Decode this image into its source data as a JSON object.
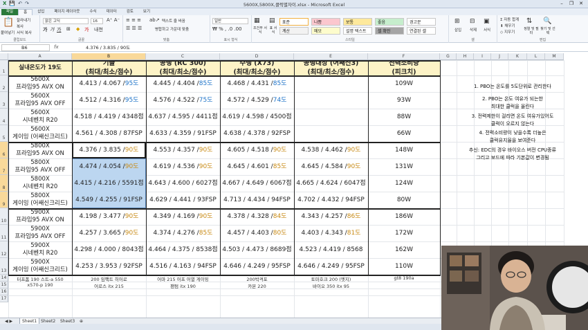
{
  "window": {
    "title": "5600X,5800X,클럭별자이.xlsx - Microsoft Excel",
    "controls": [
      "–",
      "❐",
      "✕"
    ]
  },
  "ribbon_tabs": [
    "파일",
    "홈",
    "삽입",
    "페이지 레이아웃",
    "수식",
    "데이터",
    "검토",
    "보기"
  ],
  "ribbon": {
    "paste": "붙여넣기",
    "cut": "잘라내기",
    "copy": "복사",
    "format_painter": "서식 복사",
    "font_name": "맑은 고딕",
    "font_size": "16",
    "wrap_text": "텍스트 줄 바꿈",
    "merge_center": "병합하고 가운데 맞춤",
    "number_format": "일반",
    "cond_format": "조건부 서식",
    "table_format": "표 서식",
    "styles": [
      {
        "label": "표준",
        "bg": "#ffffff",
        "border": "#f2b040"
      },
      {
        "label": "나쁨",
        "bg": "#fbc7ce",
        "border": "#c8c8c8"
      },
      {
        "label": "보통",
        "bg": "#fee99c",
        "border": "#c8c8c8"
      },
      {
        "label": "좋음",
        "bg": "#c6eecd",
        "border": "#c8c8c8"
      },
      {
        "label": "경고문",
        "bg": "#ffffff",
        "border": "#c8c8c8"
      },
      {
        "label": "계산",
        "bg": "#f2f2f2",
        "border": "#c8c8c8"
      },
      {
        "label": "메모",
        "bg": "#fdfccc",
        "border": "#c8c8c8"
      },
      {
        "label": "설명 텍스트",
        "bg": "#ffffff",
        "border": "#c8c8c8"
      },
      {
        "label": "셀 확인",
        "bg": "#a5a5a5",
        "border": "#c8c8c8"
      },
      {
        "label": "연결된 셀",
        "bg": "#ffffff",
        "border": "#c8c8c8"
      }
    ],
    "insert": "삽입",
    "delete": "삭제",
    "format": "서식",
    "autosum": "자동 합계",
    "fill": "채우기",
    "clear": "지우기",
    "sort_filter": "정렬 및 필터",
    "find_select": "찾기 및 선택",
    "groups": [
      "클립보드",
      "글꼴",
      "맞춤",
      "표시 형식",
      "스타일",
      "셀",
      "편집"
    ]
  },
  "formula_bar": {
    "name_box": "B6",
    "fx": "fx",
    "value": "4.376 / 3.835 / 90도"
  },
  "columns": [
    "A",
    "B",
    "C",
    "D",
    "E",
    "F",
    "G",
    "H",
    "I",
    "J",
    "K",
    "L",
    "M"
  ],
  "rows": [
    "1",
    "2",
    "3",
    "4",
    "5",
    "6",
    "7",
    "8",
    "9",
    "10",
    "11",
    "12",
    "13",
    "14",
    "15",
    "16",
    "17"
  ],
  "table": {
    "header_a": "실내온도가 19도",
    "headers": [
      {
        "line1": "기클",
        "line2": "(최대/최소/점수)"
      },
      {
        "line1": "공냉 (RC 300)",
        "line2": "(최대/최소/점수)"
      },
      {
        "line1": "수냉 (X73)",
        "line2": "(최대/최소/점수)"
      },
      {
        "line1": "공냉대장 (어쌔신3)",
        "line2": "(최대/최소/점수)"
      },
      {
        "line1": "전력소비량",
        "line2": "(피크치)"
      }
    ],
    "rows": [
      {
        "cpu": "5600X",
        "test": "프라임95 AVX ON",
        "b": [
          "4.413 / 4.067 / ",
          "95도",
          "b"
        ],
        "c": [
          "4.445 / 4.404 / ",
          "85도",
          "b"
        ],
        "d": [
          "4.468 / 4.431 / ",
          "85도",
          "b"
        ],
        "e": [
          "",
          "",
          ""
        ],
        "f": "109W"
      },
      {
        "cpu": "5600X",
        "test": "프라임95 AVX OFF",
        "b": [
          "4.512 / 4.316 / ",
          "95도",
          "b"
        ],
        "c": [
          "4.576 / 4.522 / ",
          "75도",
          "b"
        ],
        "d": [
          "4.572 / 4.529 / ",
          "74도",
          "b"
        ],
        "e": [
          "",
          "",
          ""
        ],
        "f": "93W"
      },
      {
        "cpu": "5600X",
        "test": "시네벤치 R20",
        "b": [
          "4.518 / 4.419 / 4348점",
          "",
          ""
        ],
        "c": [
          "4.637 / 4.595 / 4411점",
          "",
          ""
        ],
        "d": [
          "4.619 / 4.598 / 4500점",
          "",
          ""
        ],
        "e": [
          "",
          "",
          ""
        ],
        "f": "88W"
      },
      {
        "cpu": "5600X",
        "test": "게이밍 (어쌔신크리드)",
        "b": [
          "4.561 / 4.308 / 87FSP",
          "",
          ""
        ],
        "c": [
          "4.633 / 4.359 / 91FSP",
          "",
          ""
        ],
        "d": [
          "4.638 / 4.378 / 92FSP",
          "",
          ""
        ],
        "e": [
          "",
          "",
          ""
        ],
        "f": "66W"
      },
      {
        "cpu": "5800X",
        "test": "프라임95 AVX ON",
        "b": [
          "4.376 / 3.835 / ",
          "90도",
          "o"
        ],
        "c": [
          "4.553 / 4.357 / ",
          "90도",
          "o"
        ],
        "d": [
          "4.605 / 4.518 / ",
          "90도",
          "o"
        ],
        "e": [
          "4.538 / 4.462 / ",
          "90도",
          "o"
        ],
        "f": "148W"
      },
      {
        "cpu": "5800X",
        "test": "프라임95 AVX OFF",
        "b": [
          "4.474 / 4.054 / ",
          "90도",
          "o"
        ],
        "c": [
          "4.619 / 4.536 / ",
          "90도",
          "o"
        ],
        "d": [
          "4.645 / 4.601 / ",
          "85도",
          "o"
        ],
        "e": [
          "4.645 / 4.584 / ",
          "90도",
          "o"
        ],
        "f": "131W"
      },
      {
        "cpu": "5800X",
        "test": "시네벤치 R20",
        "b": [
          "4.415 / 4.216 / 5591점",
          "",
          ""
        ],
        "c": [
          "4.643 / 4.600 / 6027점",
          "",
          ""
        ],
        "d": [
          "4.667 / 4.649 / 6067점",
          "",
          ""
        ],
        "e": [
          "4.665 / 4.624 / 6047점",
          "",
          ""
        ],
        "f": "124W"
      },
      {
        "cpu": "5800X",
        "test": "게이밍 (어쌔신크리드)",
        "b": [
          "4.549 / 4.255 / 91FSP",
          "",
          ""
        ],
        "c": [
          "4.629 / 4.441 / 93FSP",
          "",
          ""
        ],
        "d": [
          "4.713 / 4.434 / 94FSP",
          "",
          ""
        ],
        "e": [
          "4.702 / 4.432 / 94FSP",
          "",
          ""
        ],
        "f": "80W"
      },
      {
        "cpu": "5900X",
        "test": "프라임95 AVX ON",
        "b": [
          "4.198 / 3.477 / ",
          "90도",
          "o"
        ],
        "c": [
          "4.349 / 4.169 / ",
          "90도",
          "o"
        ],
        "d": [
          "4.378 / 4.328 / ",
          "84도",
          "o"
        ],
        "e": [
          "4.343 / 4.257 / ",
          "86도",
          "o"
        ],
        "f": "186W"
      },
      {
        "cpu": "5900X",
        "test": "프라임95 AVX OFF",
        "b": [
          "4.257 / 3.665 / ",
          "90도",
          "o"
        ],
        "c": [
          "4.374 / 4.276 / ",
          "85도",
          "o"
        ],
        "d": [
          "4.457 / 4.403 / ",
          "80도",
          "o"
        ],
        "e": [
          "4.403 / 4.343 / ",
          "81도",
          "o"
        ],
        "f": "172W"
      },
      {
        "cpu": "5900X",
        "test": "시네벤치 R20",
        "b": [
          "4.298 / 4.000 / 8043점",
          "",
          ""
        ],
        "c": [
          "4.464 / 4.375 / 8538점",
          "",
          ""
        ],
        "d": [
          "4.503 / 4.473 / 8689점",
          "",
          ""
        ],
        "e": [
          "4.523 / 4.419 / 8568",
          "",
          ""
        ],
        "f": "162W"
      },
      {
        "cpu": "5900X",
        "test": "게이밍 (어쌔신크리드)",
        "b": [
          "4.253 / 3.953 / 92FSP",
          "",
          ""
        ],
        "c": [
          "4.516 / 4.163 / 94FSP",
          "",
          ""
        ],
        "d": [
          "4.646 / 4.249 / 95FSP",
          "",
          ""
        ],
        "e": [
          "4.646 / 4.249 / 95FSP",
          "",
          ""
        ],
        "f": "110W"
      }
    ],
    "footer": [
      [
        "터프폼 190 스트-a 550",
        "200 임팩트 히어로",
        "어마 215 어프 어열 게이밍",
        "200박격포",
        "토마호크 200 (엣지)",
        "gt8 190a"
      ],
      [
        "x570-p 190",
        "어로스 itx 215",
        "팬텀 itx 190",
        "카본 220",
        "바이오 350 itx 95",
        ""
      ]
    ]
  },
  "notes": [
    "1. PBO는 온도를 5도단위로 관리한다",
    "2. PBO는 온도 여유가 되는한",
    "최대한 클럭을 올린다",
    "3. 전력제한이 걸리면 온도 여유가있어도",
    "클럭이 오르지 않는다",
    "4. 전력소비량이 낮을수록 더높은",
    "클럭유지율을 보여준다",
    "추신: EDC의 경우 바이오스 버전 CPU종류",
    "그리고 보드에 따라 기본값이 변경됨"
  ],
  "sheets": [
    "Sheet1",
    "Sheet2",
    "Sheet3"
  ],
  "colors": {
    "temp_blue": "#1e73c8",
    "temp_orange": "#c88a14",
    "header_fill": "#fdf3c6",
    "selection": "#bcd6f0",
    "file_tab": "#2a7a3b"
  }
}
